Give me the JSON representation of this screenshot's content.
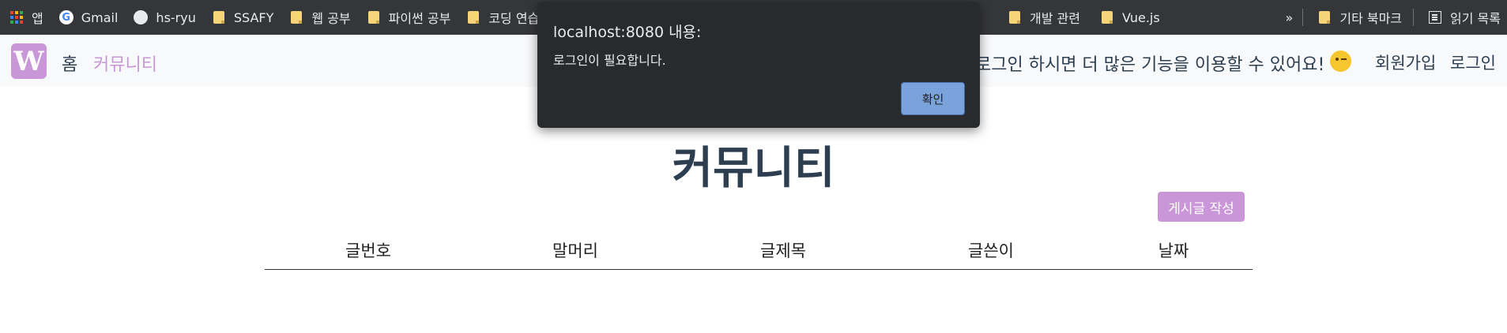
{
  "bookmarks": {
    "items": [
      {
        "label": "앱",
        "icon": "apps-grid-icon"
      },
      {
        "label": "Gmail",
        "icon": "google-icon"
      },
      {
        "label": "hs-ryu",
        "icon": "github-icon"
      },
      {
        "label": "SSAFY",
        "icon": "folder-icon"
      },
      {
        "label": "웹 공부",
        "icon": "folder-icon"
      },
      {
        "label": "파이썬 공부",
        "icon": "folder-icon"
      },
      {
        "label": "코딩 연습",
        "icon": "folder-icon"
      },
      {
        "label": "개발 관련",
        "icon": "folder-icon"
      },
      {
        "label": "Vue.js",
        "icon": "folder-icon"
      }
    ],
    "overflow": "»",
    "other_bookmarks": "기타 북마크",
    "reading_list": "읽기 목록"
  },
  "nav": {
    "logo": "W",
    "home": "홈",
    "community": "커뮤니티",
    "message": "로그인 하시면 더 많은 기능을 이용할 수 있어요!",
    "signup": "회원가입",
    "login": "로그인"
  },
  "main": {
    "title": "커뮤니티",
    "write_button": "게시글 작성",
    "columns": [
      "글번호",
      "말머리",
      "글제목",
      "글쓴이",
      "날짜"
    ]
  },
  "dialog": {
    "title": "localhost:8080 내용:",
    "message": "로그인이 필요합니다.",
    "ok": "확인"
  },
  "colors": {
    "accent": "#c997d8",
    "text": "#2c3e50",
    "dialog_bg": "#292a2d",
    "dialog_button": "#7aa2db"
  }
}
